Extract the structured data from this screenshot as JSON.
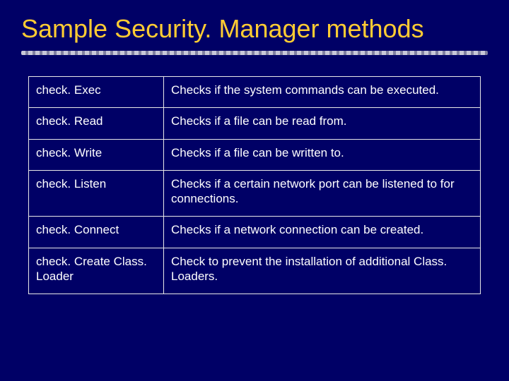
{
  "title": "Sample Security. Manager methods",
  "table": {
    "rows": [
      {
        "method": "check. Exec",
        "desc": "Checks if the system commands can be executed."
      },
      {
        "method": "check. Read",
        "desc": "Checks if a file can be read from."
      },
      {
        "method": "check. Write",
        "desc": "Checks if a file can be written to."
      },
      {
        "method": "check. Listen",
        "desc": "Checks if a certain network port can be listened to for connections."
      },
      {
        "method": "check. Connect",
        "desc": "Checks if a network connection can be created."
      },
      {
        "method": "check. Create Class. Loader",
        "desc": "Check to prevent the installation of additional Class. Loaders."
      }
    ]
  }
}
